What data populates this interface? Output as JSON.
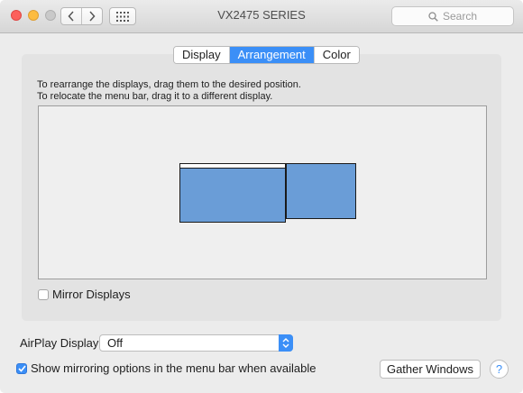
{
  "window": {
    "title": "VX2475 SERIES",
    "search_placeholder": "Search"
  },
  "tabs": [
    {
      "label": "Display",
      "active": false
    },
    {
      "label": "Arrangement",
      "active": true
    },
    {
      "label": "Color",
      "active": false
    }
  ],
  "arrangement": {
    "instruction_line1": "To rearrange the displays, drag them to the desired position.",
    "instruction_line2": "To relocate the menu bar, drag it to a different display.",
    "mirror_displays_label": "Mirror Displays",
    "mirror_displays_checked": false
  },
  "airplay": {
    "label": "AirPlay Display:",
    "selected": "Off"
  },
  "mirroring_option": {
    "label": "Show mirroring options in the menu bar when available",
    "checked": true
  },
  "buttons": {
    "gather_windows": "Gather Windows",
    "help": "?"
  },
  "colors": {
    "accent": "#3b8ff7",
    "display_fill": "#6a9dd7",
    "close": "#fc605c",
    "minimize": "#fdbc40"
  }
}
